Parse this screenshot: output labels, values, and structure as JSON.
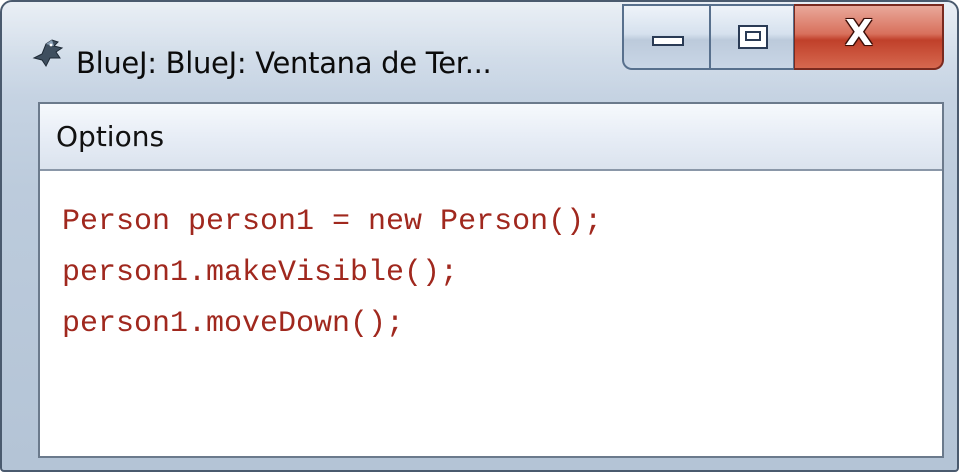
{
  "window": {
    "title": "BlueJ: BlueJ:  Ventana de Ter...",
    "app_icon": "bluej-bird-icon",
    "caption_buttons": {
      "minimize_icon": "minimize-icon",
      "maximize_icon": "maximize-icon",
      "close_icon": "close-icon",
      "close_glyph": "X"
    }
  },
  "menubar": {
    "items": [
      {
        "label": "Options"
      }
    ]
  },
  "terminal": {
    "lines": [
      "Person person1 = new Person();",
      "person1.makeVisible();",
      "person1.moveDown();"
    ],
    "text_color": "#a0281e"
  },
  "colors": {
    "close_button": "#c0402a",
    "frame": "#b4c4d6"
  }
}
